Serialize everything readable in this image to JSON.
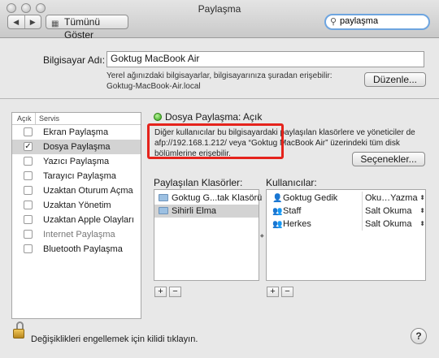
{
  "window": {
    "title": "Paylaşma",
    "show_all_label": "Tümünü Göster",
    "search_value": "paylaşma"
  },
  "computer": {
    "name_label": "Bilgisayar Adı:",
    "name_value": "Goktug MacBook Air",
    "note_line1": "Yerel ağınızdaki bilgisayarlar, bilgisayarınıza şuradan erişebilir:",
    "note_line2": "Goktug-MacBook-Air.local",
    "edit_button": "Düzenle..."
  },
  "services": {
    "col_on": "Açık",
    "col_service": "Servis",
    "items": [
      {
        "label": "Ekran Paylaşma",
        "checked": false
      },
      {
        "label": "Dosya Paylaşma",
        "checked": true
      },
      {
        "label": "Yazıcı Paylaşma",
        "checked": false
      },
      {
        "label": "Tarayıcı Paylaşma",
        "checked": false
      },
      {
        "label": "Uzaktan Oturum Açma",
        "checked": false
      },
      {
        "label": "Uzaktan Yönetim",
        "checked": false
      },
      {
        "label": "Uzaktan Apple Olayları",
        "checked": false
      },
      {
        "label": "Internet Paylaşma",
        "checked": false
      },
      {
        "label": "Bluetooth Paylaşma",
        "checked": false
      }
    ]
  },
  "detail": {
    "status": "Dosya Paylaşma: Açık",
    "status_color": "#2e9d12",
    "desc_line1": "Diğer kullanıcılar bu bilgisayardaki paylaşılan klasörlere ve yöneticiler de",
    "desc_line2": "afp://192.168.1.212/ veya “Goktug MacBook Air” üzerindeki tüm disk",
    "desc_line3": "bölümlerine erişebilir.",
    "options_button": "Seçenekler...",
    "highlight_color": "#e5231c"
  },
  "folders": {
    "header": "Paylaşılan Klasörler:",
    "items": [
      "Goktug G...tak Klasörü",
      "Sihirli Elma"
    ],
    "add": "+",
    "remove": "−"
  },
  "users": {
    "header": "Kullanıcılar:",
    "items": [
      {
        "name": "Goktug Gedik",
        "icon": "user-icon",
        "permission": "Oku…Yazma"
      },
      {
        "name": "Staff",
        "icon": "group-icon",
        "permission": "Salt Okuma"
      },
      {
        "name": "Herkes",
        "icon": "group-icon",
        "permission": "Salt Okuma"
      }
    ],
    "add": "+",
    "remove": "−"
  },
  "footer": {
    "lock_text": "Değişiklikleri engellemek için kilidi tıklayın.",
    "help": "?"
  }
}
